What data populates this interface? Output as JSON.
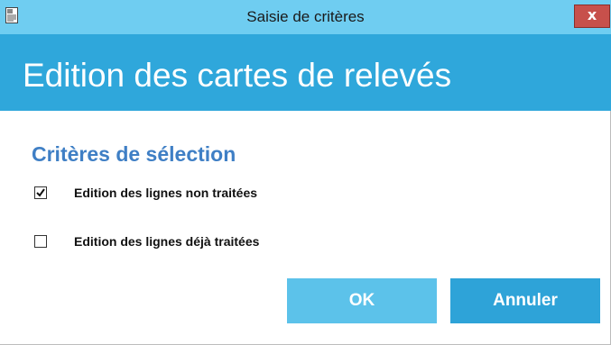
{
  "window": {
    "title": "Saisie de critères",
    "close_label": "x"
  },
  "header": {
    "title": "Edition des cartes de relevés"
  },
  "section": {
    "title": "Critères de sélection",
    "options": [
      {
        "label": "Edition des lignes non traitées",
        "checked": true
      },
      {
        "label": "Edition des lignes déjà traitées",
        "checked": false
      }
    ]
  },
  "buttons": {
    "ok_label": "OK",
    "cancel_label": "Annuler"
  },
  "colors": {
    "titlebar": "#6fcdf1",
    "header": "#2fa7db",
    "section_title": "#3f7fc5",
    "ok_button": "#5cc2ea",
    "cancel_button": "#2ea3d8",
    "close_button": "#c7504b"
  },
  "icons": {
    "window_icon": "document-icon",
    "close": "close-icon",
    "check": "checkmark-icon"
  }
}
